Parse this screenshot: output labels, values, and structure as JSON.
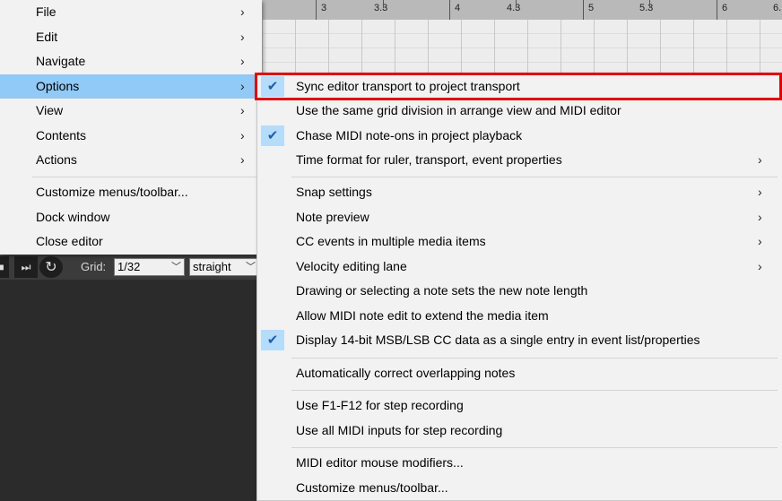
{
  "ruler": {
    "labels": [
      "3.3",
      "4.3",
      "5.3",
      "6."
    ],
    "bar_numbers": [
      "3",
      "4",
      "5",
      "6"
    ]
  },
  "toolbar": {
    "grid_label": "Grid:",
    "grid_value": "1/32",
    "swing_value": "straight"
  },
  "main_menu": {
    "items": [
      {
        "label": "File",
        "submenu": true
      },
      {
        "label": "Edit",
        "submenu": true
      },
      {
        "label": "Navigate",
        "submenu": true
      },
      {
        "label": "Options",
        "submenu": true,
        "highlighted": true
      },
      {
        "label": "View",
        "submenu": true
      },
      {
        "label": "Contents",
        "submenu": true
      },
      {
        "label": "Actions",
        "submenu": true
      },
      {
        "label": "Customize menus/toolbar..."
      },
      {
        "label": "Dock window"
      },
      {
        "label": "Close editor"
      }
    ],
    "submenu_glyph": "›"
  },
  "options_menu": {
    "items": [
      {
        "label": "Sync editor transport to project transport",
        "checked": true
      },
      {
        "label": "Use the same grid division in arrange view and MIDI editor",
        "checked": false
      },
      {
        "label": "Chase MIDI note-ons in project playback",
        "checked": true
      },
      {
        "label": "Time format for ruler, transport, event properties",
        "submenu": true
      },
      {
        "label": "Snap settings",
        "submenu": true
      },
      {
        "label": "Note preview",
        "submenu": true
      },
      {
        "label": "CC events in multiple media items",
        "submenu": true
      },
      {
        "label": "Velocity editing lane",
        "submenu": true
      },
      {
        "label": "Drawing or selecting a note sets the new note length"
      },
      {
        "label": "Allow MIDI note edit to extend the media item"
      },
      {
        "label": "Display 14-bit MSB/LSB CC data as a single entry in event list/properties",
        "checked": true
      },
      {
        "label": "Automatically correct overlapping notes"
      },
      {
        "label": "Use F1-F12 for step recording"
      },
      {
        "label": "Use all MIDI inputs for step recording"
      },
      {
        "label": "MIDI editor mouse modifiers..."
      },
      {
        "label": "Customize menus/toolbar..."
      }
    ],
    "check_glyph": "✔"
  },
  "colors": {
    "menu_bg": "#f2f2f2",
    "highlight": "#91c9f7",
    "check_bg": "#b6dcfb",
    "focus_outline": "#e00000"
  }
}
